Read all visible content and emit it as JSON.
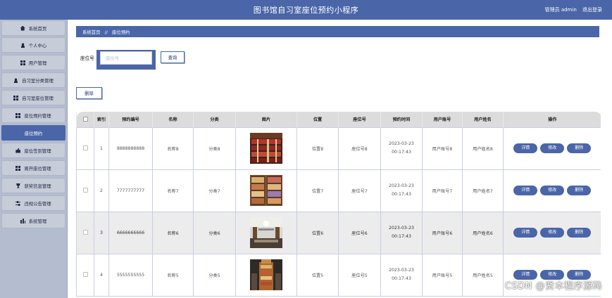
{
  "header": {
    "title": "图书馆自习室座位预约小程序",
    "user_label": "管理员 admin",
    "logout_label": "退出登录"
  },
  "sidebar": {
    "items": [
      {
        "label": "系统首页",
        "icon": "home-icon"
      },
      {
        "label": "个人中心",
        "icon": "user-icon"
      },
      {
        "label": "用户管理",
        "icon": "grid-icon"
      },
      {
        "label": "自习室分类管理",
        "icon": "user-icon"
      },
      {
        "label": "自习室座位管理",
        "icon": "grid-icon"
      },
      {
        "label": "座位预约管理",
        "icon": "grid-icon"
      },
      {
        "label": "座位预约",
        "icon": "",
        "active": true
      },
      {
        "label": "座位签到管理",
        "icon": "thumb-icon"
      },
      {
        "label": "离开座位管理",
        "icon": "grid-icon"
      },
      {
        "label": "获奖信息管理",
        "icon": "trophy-icon"
      },
      {
        "label": "违规公告管理",
        "icon": "sliders-icon"
      },
      {
        "label": "系统管理",
        "icon": "chart-icon"
      }
    ]
  },
  "breadcrumb": {
    "home": "系统首页",
    "separator": "//",
    "current": "座位预约"
  },
  "search": {
    "label": "座位号",
    "placeholder": "座位号",
    "value": "",
    "button_label": "查询"
  },
  "toolbar": {
    "delete_label": "删除"
  },
  "table": {
    "columns": [
      "索引",
      "预约编号",
      "名称",
      "分类",
      "图片",
      "位置",
      "座位号",
      "预约时间",
      "用户账号",
      "用户姓名",
      "操作"
    ],
    "actions": [
      "详情",
      "修改",
      "删除"
    ],
    "rows": [
      {
        "index": "1",
        "booking_no": "8888888888",
        "name": "名称8",
        "category": "分类8",
        "image": "bookshelf-photo",
        "location": "位置8",
        "seat": "座位号8",
        "time": "2023-03-23 00:17:43",
        "account": "用户账号8",
        "username": "用户姓名8"
      },
      {
        "index": "2",
        "booking_no": "7777777777",
        "name": "名称7",
        "category": "分类7",
        "image": "library-shelves-photo",
        "location": "位置7",
        "seat": "座位号7",
        "time": "2023-03-23 00:17:43",
        "account": "用户账号7",
        "username": "用户姓名7"
      },
      {
        "index": "3",
        "booking_no": "6666666666",
        "name": "名称6",
        "category": "分类6",
        "image": "reading-room-photo",
        "location": "位置6",
        "seat": "座位号6",
        "time": "2023-03-23 00:17:43",
        "account": "用户账号6",
        "username": "用户姓名6"
      },
      {
        "index": "4",
        "booking_no": "5555555555",
        "name": "名称5",
        "category": "分类5",
        "image": "bookshelf-tower-photo",
        "location": "位置5",
        "seat": "座位号5",
        "time": "2023-03-23 00:17:43",
        "account": "用户账号5",
        "username": "用户姓名5"
      }
    ]
  },
  "watermark": "CSDN @贤本程序源码",
  "colors": {
    "primary": "#4a66a8",
    "sidebar_bg": "#b4bccf",
    "row_alt": "#ececec",
    "header_row": "#dcdcdc"
  }
}
